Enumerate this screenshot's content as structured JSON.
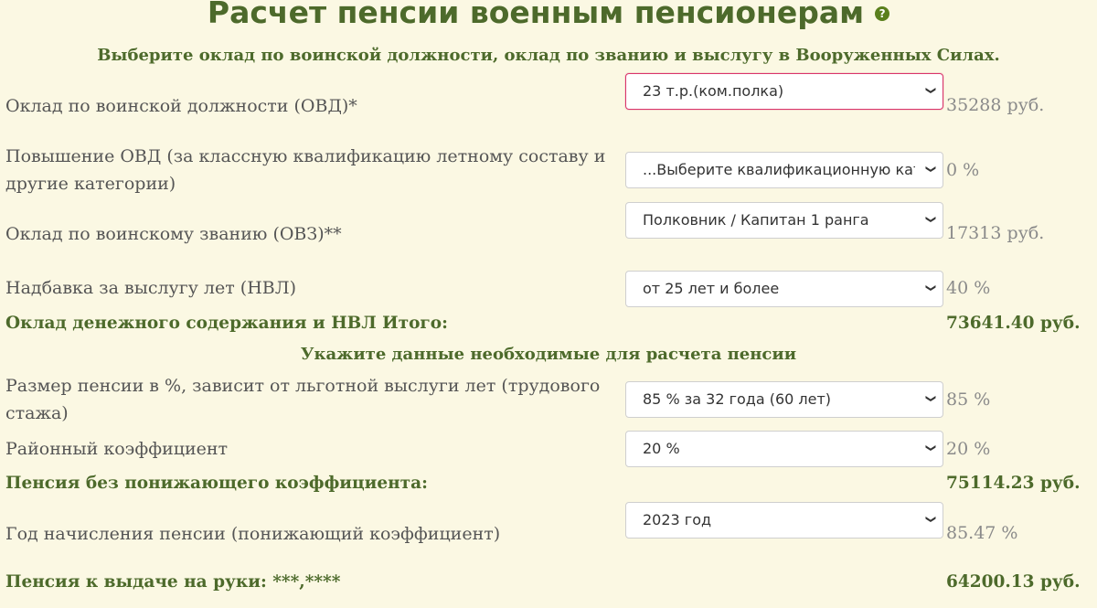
{
  "header": {
    "title": "Расчет пенсии военным пенсионерам",
    "help_icon": "?"
  },
  "section1": {
    "heading": "Выберите оклад по воинской должности, оклад по званию и выслугу в Вооруженных Силах."
  },
  "fields": {
    "ovd": {
      "label": "Оклад по воинской должности (ОВД)*",
      "value": "23 т.р.(ком.полка)",
      "result": "35288 руб."
    },
    "ovd_raise": {
      "label": "Повышение ОВД (за классную квалификацию летному составу и другие категории)",
      "value": "...Выберите квалификационную категорию",
      "result": "0 %"
    },
    "ovz": {
      "label": "Оклад по воинскому званию (ОВЗ)**",
      "value": "Полковник / Капитан 1 ранга",
      "result": "17313 руб."
    },
    "nvl": {
      "label": "Надбавка за выслугу лет (НВЛ)",
      "value": "от 25 лет и более",
      "result": "40 %"
    }
  },
  "subtotal": {
    "label": "Оклад денежного содержания и НВЛ Итого:",
    "value": "73641.40 руб."
  },
  "section2": {
    "heading": "Укажите данные необходимые для расчета пенсии"
  },
  "fields2": {
    "percent": {
      "label": "Размер пенсии в %, зависит от льготной выслуги лет (трудового стажа)",
      "value": "85 % за 32 года (60 лет)",
      "result": "85 %"
    },
    "regional": {
      "label": "Районный коэффициент",
      "value": "20 %",
      "result": "20 %"
    }
  },
  "pension_no_coef": {
    "label": "Пенсия без понижающего коэффициента:",
    "value": "75114.23 руб."
  },
  "year": {
    "label": "Год начисления пенсии (понижающий коэффициент)",
    "value": "2023 год",
    "result": "85.47 %"
  },
  "final": {
    "label": "Пенсия к выдаче на руки: ***,****",
    "value": "64200.13 руб."
  },
  "icons": {
    "dropdown": "chevron-down-icon",
    "help": "help-icon"
  },
  "colors": {
    "background": "#fbf8e3",
    "accent_green": "#4d6a2b",
    "focus_border": "#d9346b"
  }
}
